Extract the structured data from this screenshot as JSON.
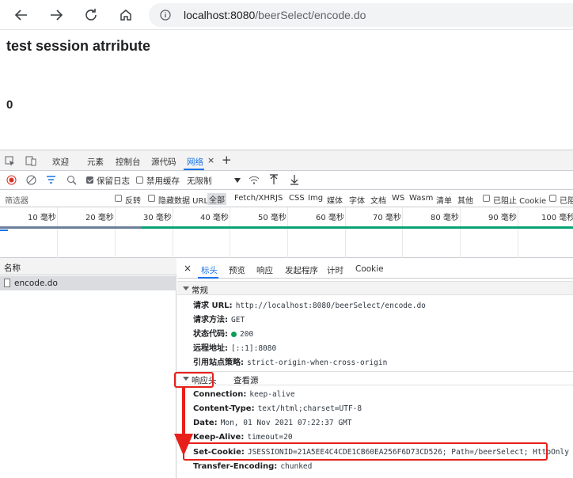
{
  "browser": {
    "url_host": "localhost:8080",
    "url_path": "/beerSelect/encode.do"
  },
  "page": {
    "title": "test session atrribute",
    "count": "0"
  },
  "devtools": {
    "tabs": [
      "欢迎",
      "元素",
      "控制台",
      "源代码",
      "网络"
    ],
    "tab_close": "×",
    "tab_add": "+",
    "controls": {
      "preserve_log": "保留日志",
      "disable_cache": "禁用缓存",
      "throttle": "无限制"
    },
    "filter": {
      "placeholder": "筛选器",
      "invert": "反转",
      "hide_data_urls": "隐藏数据 URL",
      "types": [
        "全部",
        "Fetch/XHR",
        "JS",
        "CSS",
        "Img",
        "媒体",
        "字体",
        "文档",
        "WS",
        "Wasm",
        "清单",
        "其他"
      ],
      "blocked_cookies": "已阻止 Cookie",
      "blocked_requests": "已阻"
    },
    "timeline": {
      "ticks": [
        "10 毫秒",
        "20 毫秒",
        "30 毫秒",
        "40 毫秒",
        "50 毫秒",
        "60 毫秒",
        "70 毫秒",
        "80 毫秒",
        "90 毫秒",
        "100 毫秒"
      ]
    },
    "request_list": {
      "header": "名称",
      "rows": [
        "encode.do"
      ]
    },
    "detail_tabs": [
      "×",
      "标头",
      "预览",
      "响应",
      "发起程序",
      "计时",
      "Cookie"
    ],
    "general": {
      "title": "常规",
      "rows": [
        {
          "k": "请求 URL:",
          "v": "http://localhost:8080/beerSelect/encode.do"
        },
        {
          "k": "请求方法:",
          "v": "GET"
        },
        {
          "k": "状态代码:",
          "v": "200"
        },
        {
          "k": "远程地址:",
          "v": "[::1]:8080"
        },
        {
          "k": "引用站点策略:",
          "v": "strict-origin-when-cross-origin"
        }
      ]
    },
    "response_headers": {
      "title": "响应头",
      "view_source": "查看源",
      "rows": [
        {
          "k": "Connection:",
          "v": "keep-alive"
        },
        {
          "k": "Content-Type:",
          "v": "text/html;charset=UTF-8"
        },
        {
          "k": "Date:",
          "v": "Mon, 01 Nov 2021 07:22:37 GMT"
        },
        {
          "k": "Keep-Alive:",
          "v": "timeout=20"
        },
        {
          "k": "Set-Cookie:",
          "v": "JSESSIONID=21A5EE4C4CDE1CB60EA256F6D73CD526; Path=/beerSelect; HttpOnly"
        },
        {
          "k": "Transfer-Encoding:",
          "v": "chunked"
        }
      ]
    }
  },
  "colors": {
    "accent": "#1a73e8",
    "annotation": "#e8201b",
    "status_ok": "#0d9d58"
  }
}
